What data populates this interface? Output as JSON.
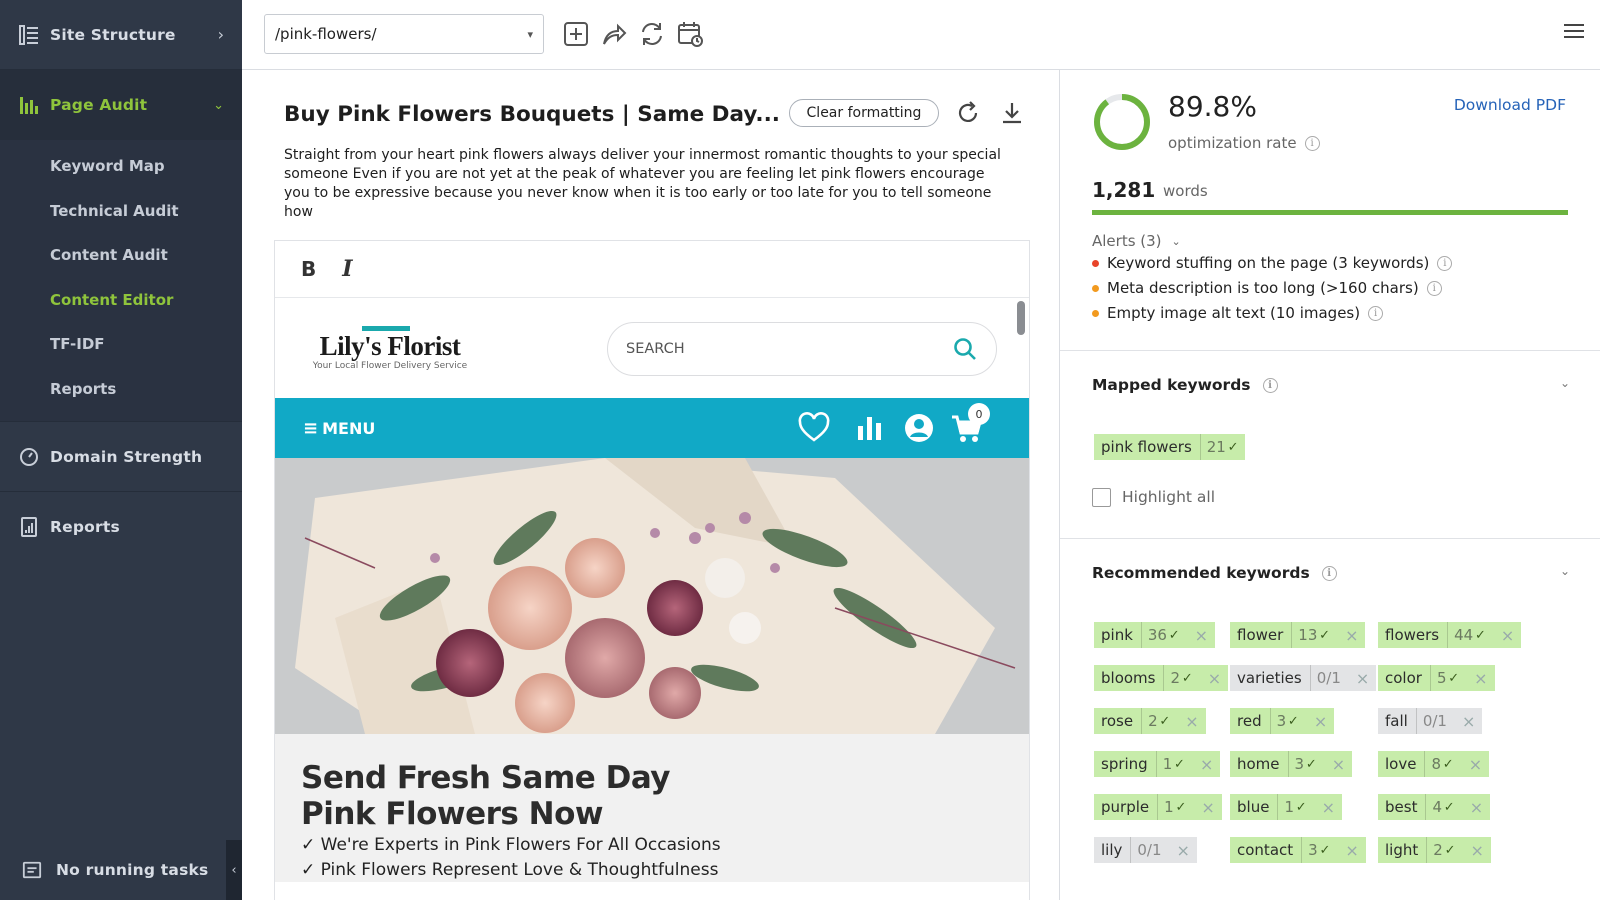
{
  "sidebar": {
    "site_structure": "Site Structure",
    "page_audit": "Page Audit",
    "sub_items": [
      "Keyword Map",
      "Technical Audit",
      "Content Audit",
      "Content Editor",
      "TF-IDF",
      "Reports"
    ],
    "active_sub": "Content Editor",
    "domain_strength": "Domain Strength",
    "reports": "Reports",
    "footer": "No running tasks"
  },
  "toolbar": {
    "url": "/pink-flowers/"
  },
  "editor": {
    "title": "Buy Pink Flowers Bouquets | Same Day...",
    "clear_formatting": "Clear formatting",
    "description": "Straight from your heart pink flowers always deliver your innermost romantic thoughts to your special someone Even if you are not yet at the peak of whatever you are feeling let pink flowers encourage you to be expressive because you never know when it is too early or too late for you to tell someone how",
    "bold_label": "B",
    "italic_label": "I"
  },
  "preview": {
    "logo": "Lily's Florist",
    "logo_tagline": "Your Local Flower Delivery Service",
    "search_placeholder": "SEARCH",
    "menu_label": "MENU",
    "cart_count": "0",
    "heading_line1": "Send Fresh Same Day",
    "heading_line2": "Pink Flowers Now",
    "bullets": [
      "✓ We're Experts in Pink Flowers For All Occasions",
      "✓ Pink Flowers Represent Love & Thoughtfulness"
    ]
  },
  "panel": {
    "rate": "89.8%",
    "rate_value": 89.8,
    "rate_label": "optimization rate",
    "download_pdf": "Download PDF",
    "words_count": "1,281",
    "words_label": "words",
    "alerts_header": "Alerts (3)",
    "alerts": [
      {
        "text": "Keyword stuffing on the page (3 keywords)",
        "color": "#e8442a"
      },
      {
        "text": "Meta description is too long (>160 chars)",
        "color": "#f29a1f"
      },
      {
        "text": "Empty image alt text (10 images)",
        "color": "#f29a1f"
      }
    ],
    "mapped_title": "Mapped keywords",
    "mapped": [
      {
        "kw": "pink flowers",
        "cnt": "21"
      }
    ],
    "highlight_all": "Highlight all",
    "recommended_title": "Recommended keywords",
    "recommended": [
      {
        "kw": "pink",
        "cnt": "36",
        "ok": true
      },
      {
        "kw": "flower",
        "cnt": "13",
        "ok": true
      },
      {
        "kw": "flowers",
        "cnt": "44",
        "ok": true
      },
      {
        "kw": "blooms",
        "cnt": "2",
        "ok": true
      },
      {
        "kw": "varieties",
        "cnt": "0/1",
        "ok": false
      },
      {
        "kw": "color",
        "cnt": "5",
        "ok": true
      },
      {
        "kw": "rose",
        "cnt": "2",
        "ok": true
      },
      {
        "kw": "red",
        "cnt": "3",
        "ok": true
      },
      {
        "kw": "fall",
        "cnt": "0/1",
        "ok": false
      },
      {
        "kw": "spring",
        "cnt": "1",
        "ok": true
      },
      {
        "kw": "home",
        "cnt": "3",
        "ok": true
      },
      {
        "kw": "love",
        "cnt": "8",
        "ok": true
      },
      {
        "kw": "purple",
        "cnt": "1",
        "ok": true
      },
      {
        "kw": "blue",
        "cnt": "1",
        "ok": true
      },
      {
        "kw": "best",
        "cnt": "4",
        "ok": true
      },
      {
        "kw": "lily",
        "cnt": "0/1",
        "ok": false
      },
      {
        "kw": "contact",
        "cnt": "3",
        "ok": true
      },
      {
        "kw": "light",
        "cnt": "2",
        "ok": true
      }
    ]
  },
  "colors": {
    "accent_green": "#8fc43c",
    "sidebar_bg": "#2f3847",
    "nav_teal": "#11a9c6",
    "link_blue": "#2663b8"
  }
}
